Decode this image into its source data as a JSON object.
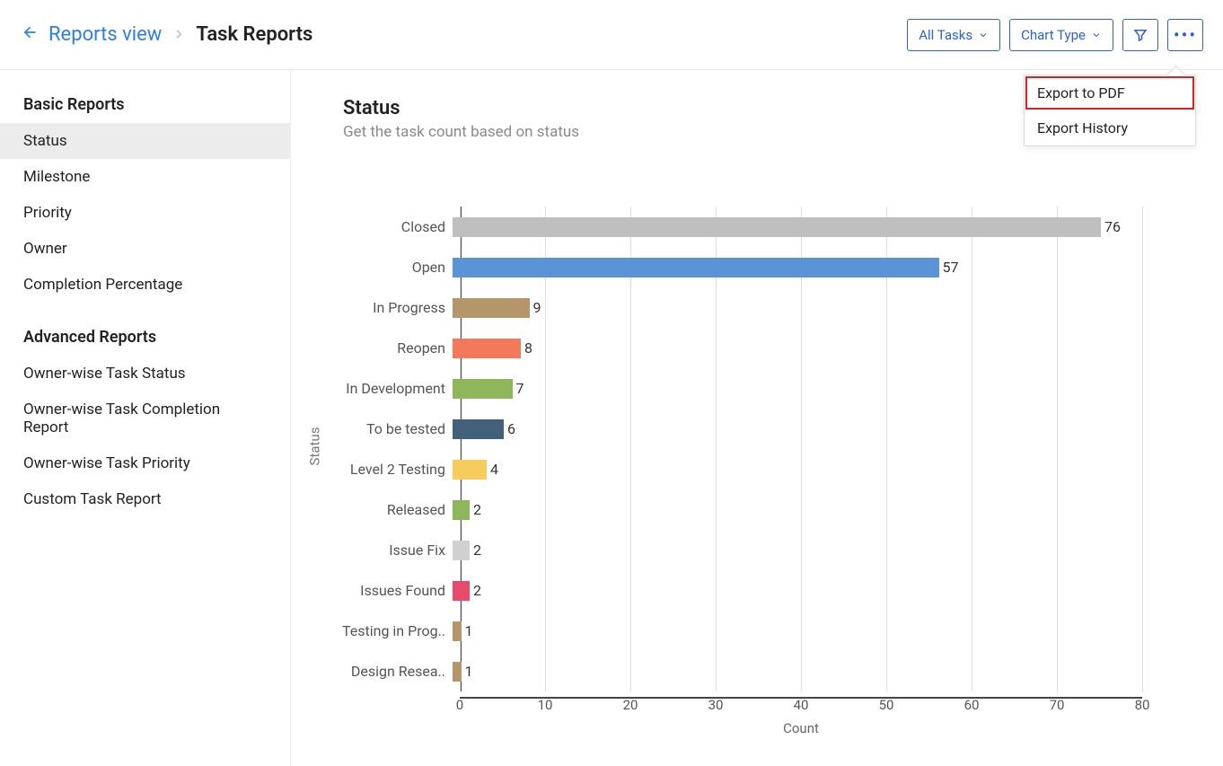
{
  "header": {
    "back_link": "Reports view",
    "page_title": "Task Reports",
    "buttons": {
      "tasks_filter": "All Tasks",
      "chart_type": "Chart Type"
    },
    "menu": {
      "export_pdf": "Export to PDF",
      "export_history": "Export History"
    }
  },
  "sidebar": {
    "basic_title": "Basic Reports",
    "basic_items": [
      "Status",
      "Milestone",
      "Priority",
      "Owner",
      "Completion Percentage"
    ],
    "advanced_title": "Advanced Reports",
    "advanced_items": [
      "Owner-wise Task Status",
      "Owner-wise Task Completion Report",
      "Owner-wise Task Priority",
      "Custom Task Report"
    ],
    "active_index": 0
  },
  "main": {
    "title": "Status",
    "subtitle": "Get the task count based on status"
  },
  "chart_data": {
    "type": "bar",
    "orientation": "horizontal",
    "title": "Status",
    "xlabel": "Count",
    "ylabel": "Status",
    "xlim": [
      0,
      80
    ],
    "xticks": [
      0,
      10,
      20,
      30,
      40,
      50,
      60,
      70,
      80
    ],
    "categories": [
      "Closed",
      "Open",
      "In Progress",
      "Reopen",
      "In Development",
      "To be tested",
      "Level 2 Testing",
      "Released",
      "Issue Fix",
      "Issues Found",
      "Testing in Prog..",
      "Design Resea.."
    ],
    "values": [
      76,
      57,
      9,
      8,
      7,
      6,
      4,
      2,
      2,
      2,
      1,
      1
    ],
    "colors": [
      "#bfbfbf",
      "#5a94d6",
      "#b4966a",
      "#f3795a",
      "#8eb65a",
      "#43607b",
      "#f6cd5d",
      "#8eb65a",
      "#d0d0d0",
      "#e84a6b",
      "#b4966a",
      "#b4966a"
    ]
  }
}
